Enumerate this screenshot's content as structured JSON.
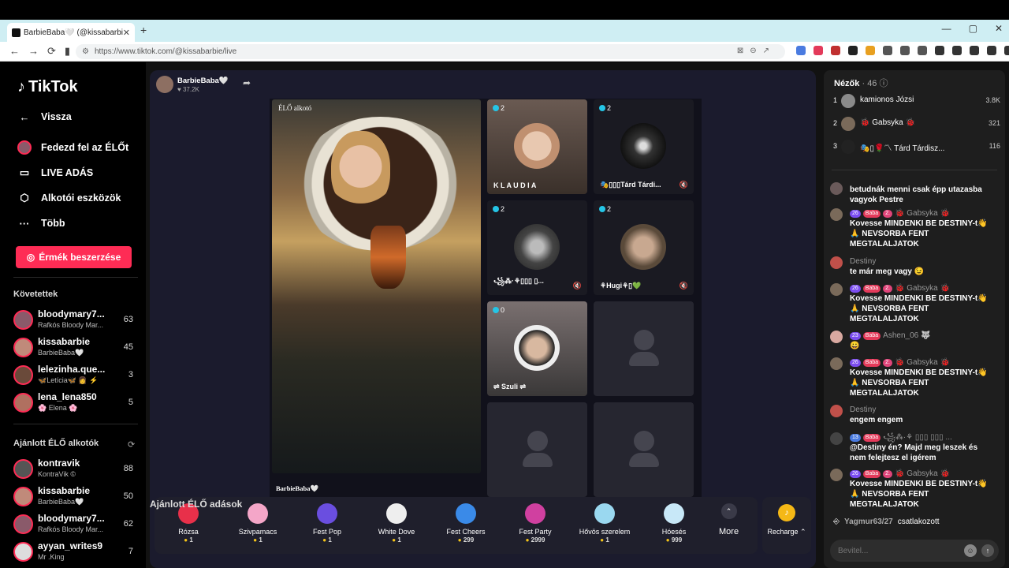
{
  "browser": {
    "tab_title": "BarbieBaba🤍 (@kissabarbie",
    "tab_close": "✕",
    "new_tab": "+",
    "window_controls": [
      "—",
      "▢",
      "✕"
    ],
    "nav": [
      "←",
      "→",
      "⟳",
      "▮"
    ],
    "url": "https://www.tiktok.com/@kissabarbie/live",
    "url_icon": "⚙",
    "url_actions": [
      "⊠",
      "⊖",
      "↗"
    ]
  },
  "sidebar": {
    "logo_note": "♪",
    "logo_text": "TikTok",
    "back_label": "Vissza",
    "items": [
      {
        "label": "Fedezd fel az ÉLŐt",
        "icon": "discover-live-icon"
      },
      {
        "label": "LIVE ADÁS",
        "icon": "camera-icon"
      },
      {
        "label": "Alkotói eszközök",
        "icon": "creator-tools-icon"
      },
      {
        "label": "Több",
        "icon": "more-icon"
      }
    ],
    "coins_button": "Érmék beszerzése",
    "following_title": "Követettek",
    "following": [
      {
        "name": "bloodymary7...",
        "sub": "Rafkós Bloody Mar...",
        "count": "63"
      },
      {
        "name": "kissabarbie",
        "sub": "BarbieBaba🤍",
        "count": "45"
      },
      {
        "name": "lelezinha.que...",
        "sub": "🦋Letícia🦋 👩 ⚡",
        "count": "3"
      },
      {
        "name": "lena_lena850",
        "sub": "🌸 Elena 🌸",
        "count": "5"
      }
    ],
    "recommended_title": "Ajánlott ÉLŐ alkotók",
    "refresh_icon": "⟳",
    "recommended": [
      {
        "name": "kontravik",
        "sub": "KontraVik ©",
        "count": "88"
      },
      {
        "name": "kissabarbie",
        "sub": "BarbieBaba🤍",
        "count": "50"
      },
      {
        "name": "bloodymary7...",
        "sub": "Rafkós Bloody Mar...",
        "count": "62"
      },
      {
        "name": "ayyan_writes9",
        "sub": "Mr .King",
        "count": "7"
      }
    ]
  },
  "live": {
    "host_name": "BarbieBaba🤍",
    "host_likes": "♥ 37.2K",
    "share_icon": "➦",
    "main_label": "ÉLŐ alkotó",
    "caption": "BarbieBaba🤍",
    "guests": [
      {
        "label": "K L A U D I A",
        "badge": "2",
        "mute": ""
      },
      {
        "label": "🎭▯▯▯Tárd Tárdi...",
        "badge": "2",
        "mute": "🔇"
      },
      {
        "label": "꧁⁂·⚘▯▯▯ ▯...",
        "badge": "2",
        "mute": "🔇"
      },
      {
        "label": "⚘Hugi⚘▯💚",
        "badge": "2",
        "mute": "🔇"
      },
      {
        "label": "⇌ Szuli ⇌",
        "badge": "0",
        "mute": ""
      }
    ],
    "gifts": [
      {
        "name": "Rózsa",
        "price": "1",
        "color": "#e8304a"
      },
      {
        "name": "Szivpamacs",
        "price": "1",
        "color": "#f4a6c8"
      },
      {
        "name": "Fest Pop",
        "price": "1",
        "color": "#6a4ee0"
      },
      {
        "name": "White Dove",
        "price": "1",
        "color": "#eeeeee"
      },
      {
        "name": "Fest Cheers",
        "price": "299",
        "color": "#3a8ae8"
      },
      {
        "name": "Fest Party",
        "price": "2999",
        "color": "#d040a0"
      },
      {
        "name": "Hővös szerelem",
        "price": "1",
        "color": "#9ad8f0"
      },
      {
        "name": "Hóesés",
        "price": "999",
        "color": "#c8e8f8"
      }
    ],
    "more_label": "More",
    "more_icon": "⌃",
    "recharge_label": "Recharge ⌃",
    "recharge_icon": "♪",
    "coin_glyph": "●",
    "suggest_title": "Ajánlott ÉLŐ adások"
  },
  "viewers": {
    "title": "Nézők",
    "count": "· 46 ⓘ",
    "list": [
      {
        "rank": "1",
        "name": "kamionos Józsi",
        "score": "3.8K"
      },
      {
        "rank": "2",
        "name": "🐞 Gabsyka 🐞",
        "score": "321"
      },
      {
        "rank": "3",
        "name": "🎭▯🌹〽 Tárd Tárdisz...",
        "score": "116"
      }
    ]
  },
  "chat": [
    {
      "header": "",
      "badges": [],
      "text": "betudnák menni csak épp utazasba vagyok Pestre"
    },
    {
      "header": "🐞 Gabsyka 🐞",
      "badges": [
        [
          "26",
          "purple"
        ],
        [
          "Baba",
          "red"
        ],
        [
          "2.",
          "pink"
        ]
      ],
      "text": "Kovesse MINDENKI BE DESTINY-t👋🙏 NEVSORBA FENT MEGTALALJATOK"
    },
    {
      "header": "Destiny",
      "badges": [],
      "text": "te már meg vagy 😉"
    },
    {
      "header": "🐞 Gabsyka 🐞",
      "badges": [
        [
          "26",
          "purple"
        ],
        [
          "Baba",
          "red"
        ],
        [
          "2.",
          "pink"
        ]
      ],
      "text": "Kovesse MINDENKI BE DESTINY-t👋🙏 NEVSORBA FENT MEGTALALJATOK"
    },
    {
      "header": "Ashen_06 🐺",
      "badges": [
        [
          "23",
          "purple"
        ],
        [
          "Baba",
          "red"
        ]
      ],
      "text": "😀"
    },
    {
      "header": "🐞 Gabsyka 🐞",
      "badges": [
        [
          "26",
          "purple"
        ],
        [
          "Baba",
          "red"
        ],
        [
          "2.",
          "pink"
        ]
      ],
      "text": "Kovesse MINDENKI BE DESTINY-t👋🙏 NEVSORBA FENT MEGTALALJATOK"
    },
    {
      "header": "Destiny",
      "badges": [],
      "text": "engem engem"
    },
    {
      "header": "꧁⁂·⚘ ▯▯▯ ▯▯▯ ...",
      "badges": [
        [
          "13",
          "blue"
        ],
        [
          "Baba",
          "red"
        ]
      ],
      "text": "@Destiny én? Majd meg leszek és nem felejtesz el igérem"
    },
    {
      "header": "🐞 Gabsyka 🐞",
      "badges": [
        [
          "26",
          "purple"
        ],
        [
          "Baba",
          "red"
        ],
        [
          "2.",
          "pink"
        ]
      ],
      "text": "Kovesse MINDENKI BE DESTINY-t👋🙏 NEVSORBA FENT MEGTALALJATOK"
    }
  ],
  "joined": {
    "user": "Yagmur63/27",
    "text": "csatlakozott"
  },
  "input": {
    "placeholder": "Bevitel...",
    "emoji_icon": "☺",
    "send_icon": "↑"
  }
}
